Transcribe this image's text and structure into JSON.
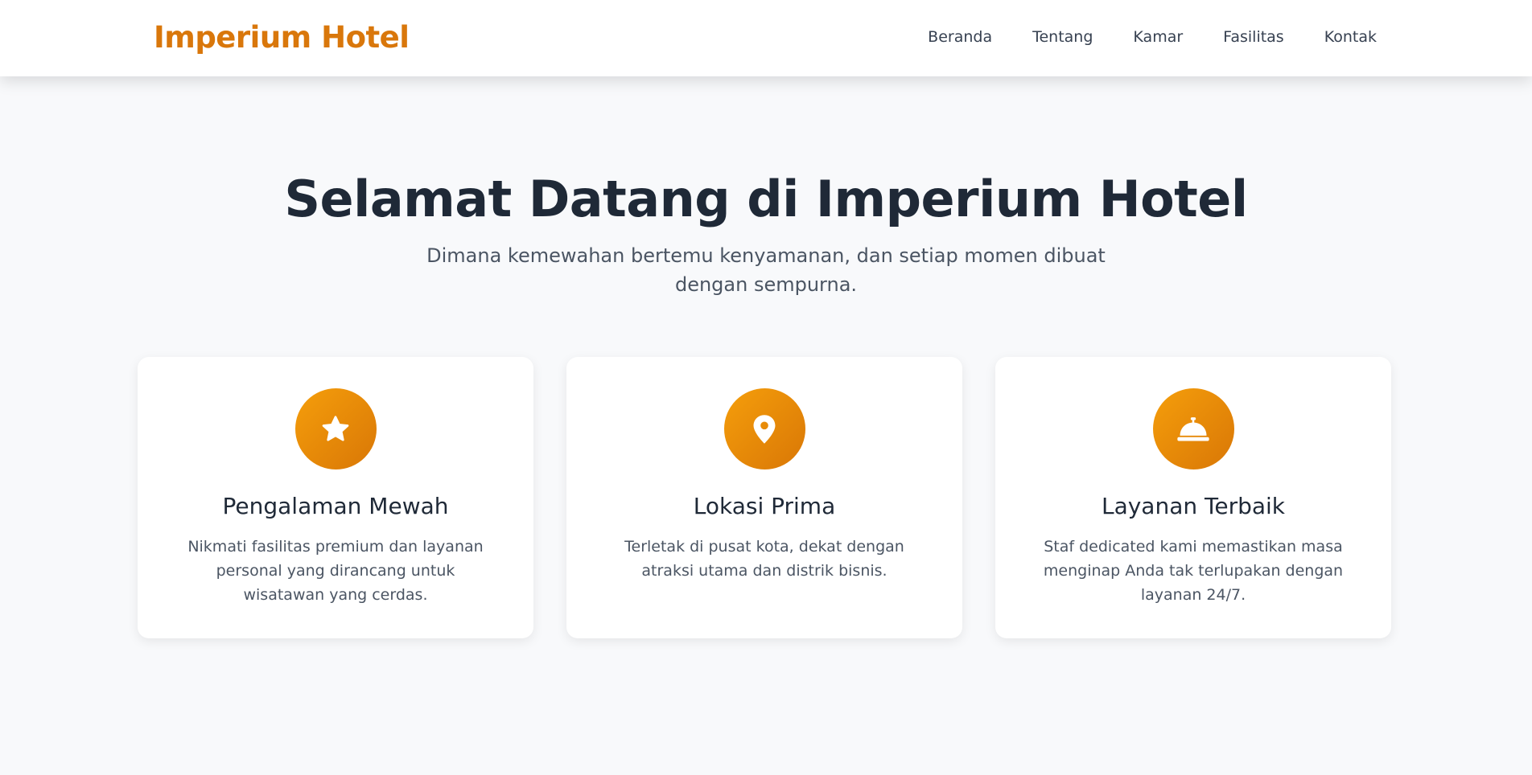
{
  "header": {
    "brand": "Imperium Hotel",
    "nav": [
      "Beranda",
      "Tentang",
      "Kamar",
      "Fasilitas",
      "Kontak"
    ]
  },
  "hero": {
    "title": "Selamat Datang di Imperium Hotel",
    "subtitle": "Dimana kemewahan bertemu kenyamanan, dan setiap momen dibuat dengan sempurna."
  },
  "features": [
    {
      "icon": "star-icon",
      "title": "Pengalaman Mewah",
      "description": "Nikmati fasilitas premium dan layanan personal yang dirancang untuk wisatawan yang cerdas."
    },
    {
      "icon": "location-pin-icon",
      "title": "Lokasi Prima",
      "description": "Terletak di pusat kota, dekat dengan atraksi utama dan distrik bisnis."
    },
    {
      "icon": "concierge-bell-icon",
      "title": "Layanan Terbaik",
      "description": "Staf dedicated kami memastikan masa menginap Anda tak terlupakan dengan layanan 24/7."
    }
  ],
  "colors": {
    "brand": "#d9770b",
    "accent_gradient_start": "#f59e0b",
    "accent_gradient_end": "#d97706",
    "background": "#f8f9fb",
    "heading": "#1f2937",
    "body_text": "#4b5563"
  }
}
